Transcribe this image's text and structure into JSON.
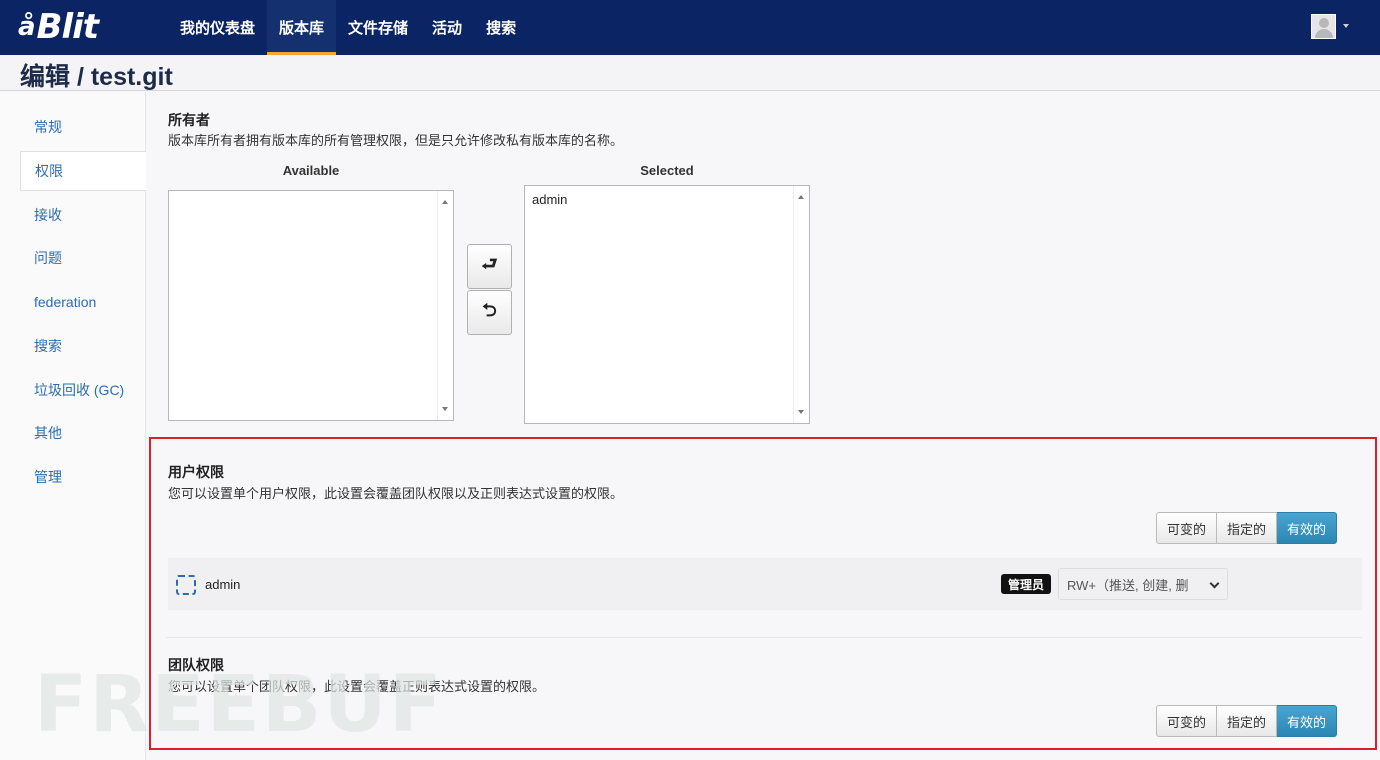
{
  "brand": {
    "mark": "å",
    "name": "Blit"
  },
  "nav": {
    "items": [
      {
        "label": "我的仪表盘",
        "active": false
      },
      {
        "label": "版本库",
        "active": true
      },
      {
        "label": "文件存储",
        "active": false
      },
      {
        "label": "活动",
        "active": false
      },
      {
        "label": "搜索",
        "active": false
      }
    ]
  },
  "page": {
    "title": "编辑 / test.git"
  },
  "sidebar": {
    "items": [
      {
        "label": "常规",
        "active": false
      },
      {
        "label": "权限",
        "active": true
      },
      {
        "label": "接收",
        "active": false
      },
      {
        "label": "问题",
        "active": false
      },
      {
        "label": "federation",
        "active": false
      },
      {
        "label": "搜索",
        "active": false
      },
      {
        "label": "垃圾回收 (GC)",
        "active": false
      },
      {
        "label": "其他",
        "active": false
      },
      {
        "label": "管理",
        "active": false
      }
    ]
  },
  "owners": {
    "title": "所有者",
    "description": "版本库所有者拥有版本库的所有管理权限，但是只允许修改私有版本库的名称。",
    "available_label": "Available",
    "selected_label": "Selected",
    "available_items": [],
    "selected_items": [
      "admin"
    ],
    "add_glyph": "⮐",
    "remove_glyph": "⮌"
  },
  "user_permissions": {
    "title": "用户权限",
    "description": "您可以设置单个用户权限，此设置会覆盖团队权限以及正则表达式设置的权限。",
    "filters": [
      "可变的",
      "指定的",
      "有效的"
    ],
    "active_filter": "有效的",
    "row": {
      "user": "admin",
      "badge": "管理员",
      "permission": "RW+（推送, 创建, 删"
    }
  },
  "team_permissions": {
    "title": "团队权限",
    "description": "您可以设置单个团队权限，此设置会覆盖正则表达式设置的权限。",
    "filters": [
      "可变的",
      "指定的",
      "有效的"
    ],
    "active_filter": "有效的"
  },
  "watermark": "FREEBUF",
  "colors": {
    "navbar": "#0a2464",
    "accent": "#f0a830",
    "link": "#2a6db5",
    "primary": "#2b86b4",
    "highlight": "#d6202c"
  }
}
